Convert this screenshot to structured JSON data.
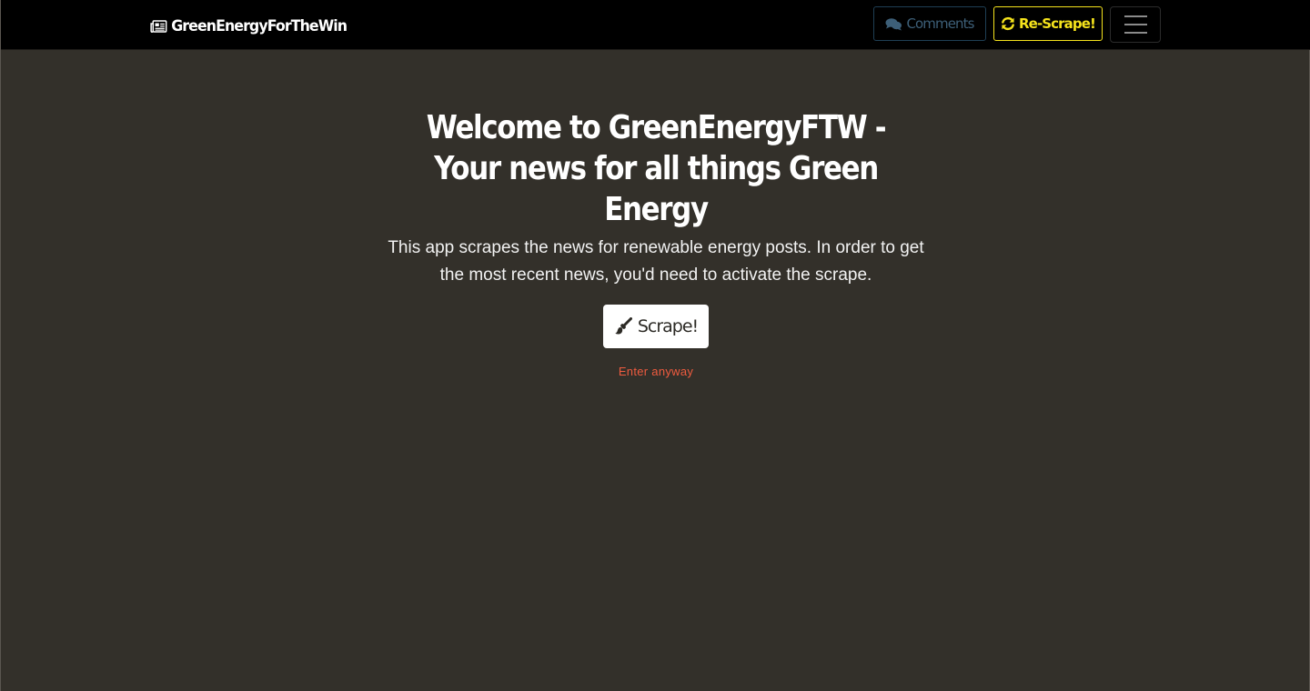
{
  "navbar": {
    "brand": "GreenEnergyForTheWin",
    "brand_icon": "newspaper-icon",
    "comments_label": "Comments",
    "comments_icon": "comments-icon",
    "rescrape_label": "Re-Scrape!",
    "rescrape_icon": "sync-icon",
    "toggler_icon": "hamburger-icon"
  },
  "hero": {
    "title": "Welcome to GreenEnergyFTW - Your news for all things Green Energy",
    "description": "This app scrapes the news for renewable energy posts. In order to get the most recent news, you'd need to activate the scrape.",
    "scrape_label": "Scrape!",
    "scrape_icon": "paintbrush-icon",
    "enter_link": "Enter anyway"
  },
  "colors": {
    "background": "#33302a",
    "navbar": "#000000",
    "rescrape_accent": "#f5e31c",
    "comments_accent": "#3d5f78",
    "enter_link": "#ef5b3f"
  }
}
